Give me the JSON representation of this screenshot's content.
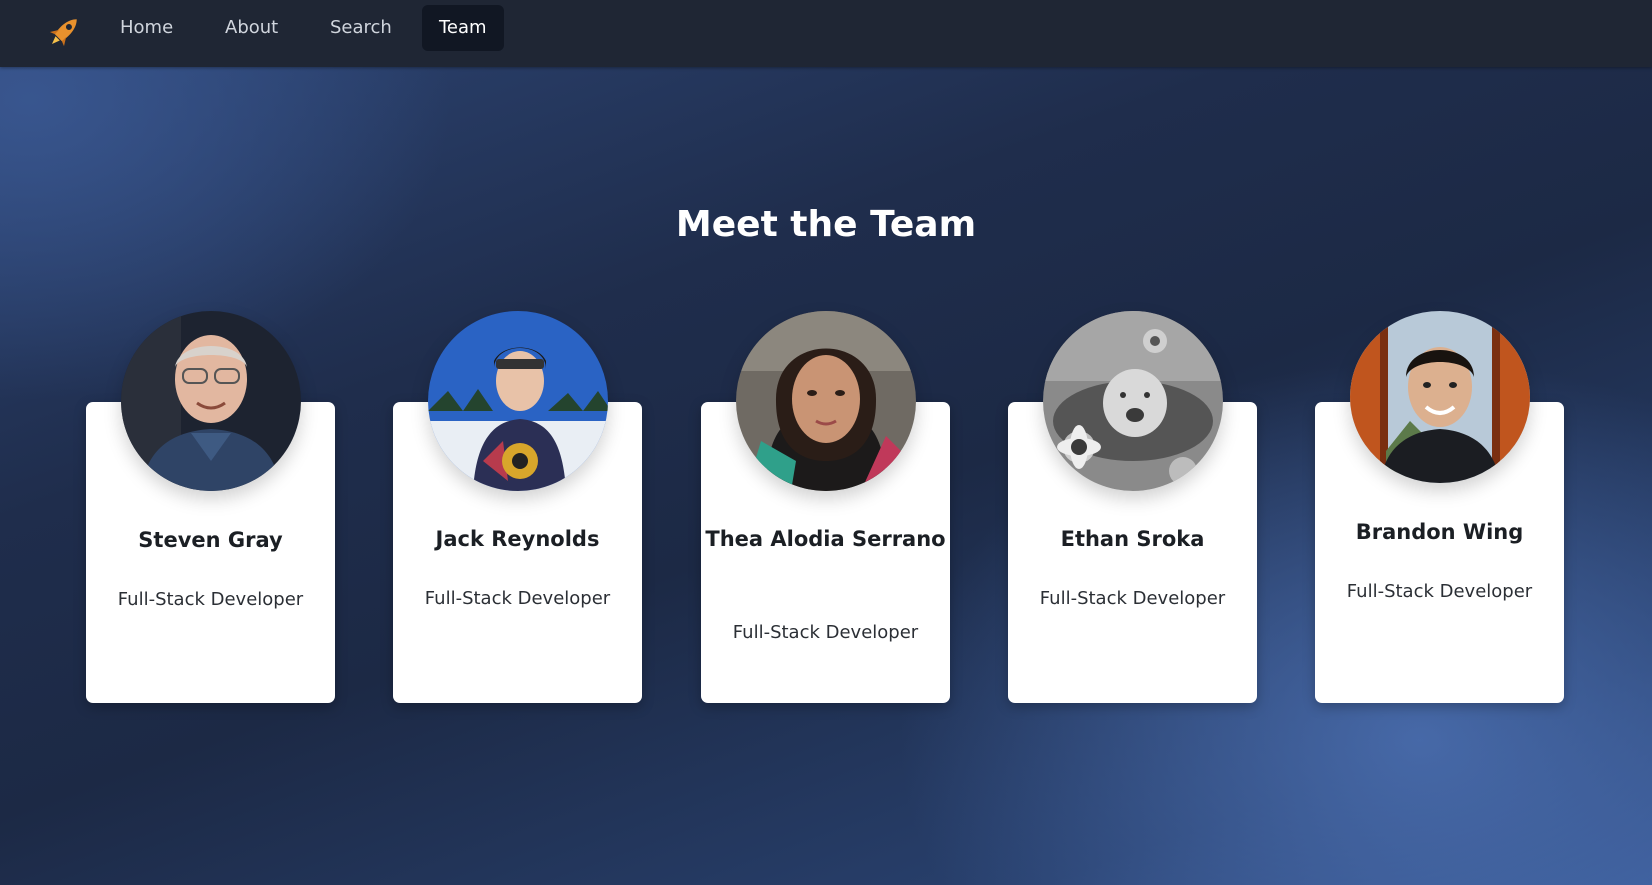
{
  "navbar": {
    "brand_icon": "rocket-icon",
    "links": [
      {
        "label": "Home",
        "active": false
      },
      {
        "label": "About",
        "active": false
      },
      {
        "label": "Search",
        "active": false
      },
      {
        "label": "Team",
        "active": true
      }
    ]
  },
  "main": {
    "title": "Meet the Team",
    "members": [
      {
        "name": "Steven Gray",
        "role": "Full-Stack Developer"
      },
      {
        "name": "Jack Reynolds",
        "role": "Full-Stack Developer"
      },
      {
        "name": "Thea Alodia Serrano",
        "role": "Full-Stack Developer"
      },
      {
        "name": "Ethan Sroka",
        "role": "Full-Stack Developer"
      },
      {
        "name": "Brandon Wing",
        "role": "Full-Stack Developer"
      }
    ]
  },
  "colors": {
    "navbar_bg": "#1f2634",
    "active_link_bg": "#111723",
    "card_bg": "#ffffff",
    "rocket_accent": "#e8912d"
  }
}
